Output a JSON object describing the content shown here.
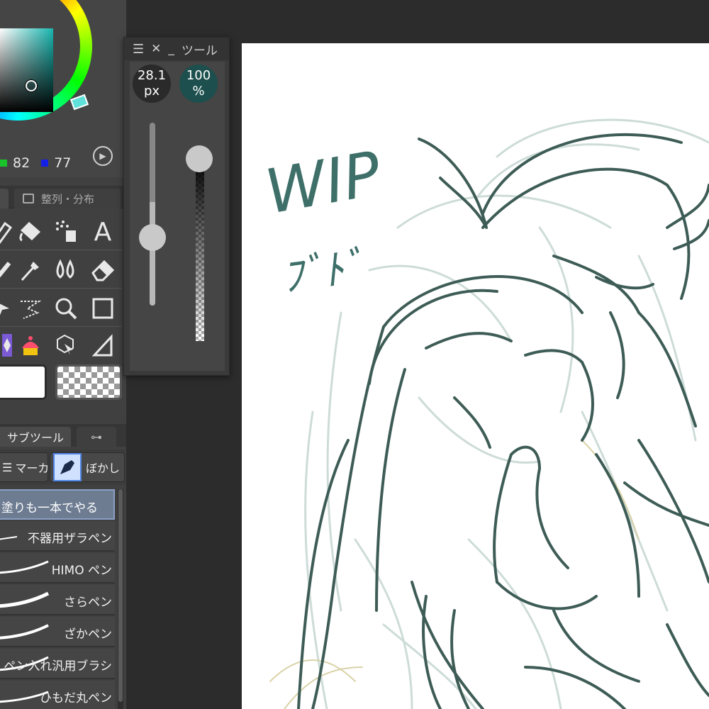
{
  "color_panel": {
    "green_value": "82",
    "blue_value": "77",
    "accent_color": "#19b6b0"
  },
  "tabs": {
    "align_distribute": "整列・分布"
  },
  "tools": [
    {
      "name": "pen-tool-icon"
    },
    {
      "name": "fill-tool-icon"
    },
    {
      "name": "airbrush-tool-icon"
    },
    {
      "name": "text-tool-icon"
    },
    {
      "name": "marker-tool-icon"
    },
    {
      "name": "eyedropper-tool-icon"
    },
    {
      "name": "blend-tool-icon"
    },
    {
      "name": "eraser-tool-icon"
    },
    {
      "name": "move-tool-icon"
    },
    {
      "name": "lasso-tool-icon"
    },
    {
      "name": "zoom-tool-icon"
    },
    {
      "name": "rectangle-tool-icon"
    },
    {
      "name": "figure-tool-icon"
    },
    {
      "name": "decoration-tool-icon"
    },
    {
      "name": "3d-object-tool-icon"
    },
    {
      "name": "ruler-tool-icon"
    }
  ],
  "text_tool_glyph": "A",
  "subtool": {
    "tab_label": "サブツール",
    "group_a": "マーカ",
    "group_b": "ぼかし"
  },
  "brushes": [
    {
      "label": "塗りも一本でやる",
      "selected": true
    },
    {
      "label": "不器用ザラペン",
      "selected": false
    },
    {
      "label": "HIMO ペン",
      "selected": false
    },
    {
      "label": "さらペン",
      "selected": false
    },
    {
      "label": "ざかペン",
      "selected": false
    },
    {
      "label": "ペン入れ汎用ブラシ",
      "selected": false
    },
    {
      "label": "ひもだ丸ペン",
      "selected": false
    }
  ],
  "tool_panel": {
    "title": "ツール",
    "brush_size_value": "28.1",
    "brush_size_unit": "px",
    "opacity_value": "100",
    "opacity_unit": "%",
    "opacity_percent": 100
  },
  "canvas": {
    "wip_text": "WIP",
    "signature_text": "ﾌﾞﾄﾞ",
    "line_color": "#3c5b55",
    "sketch_color": "#c9dad6"
  }
}
